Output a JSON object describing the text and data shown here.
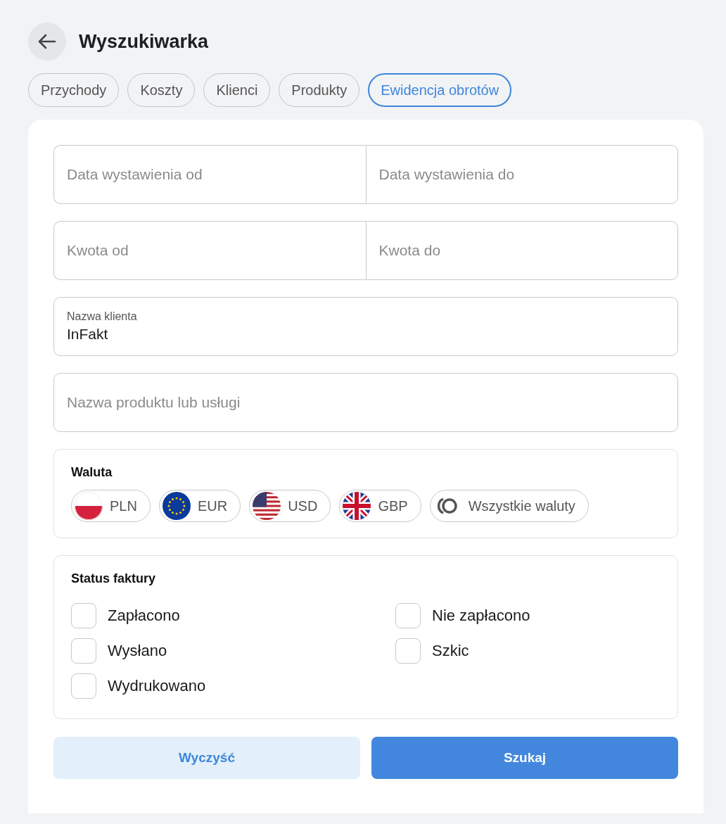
{
  "header": {
    "title": "Wyszukiwarka"
  },
  "tabs": [
    {
      "label": "Przychody",
      "selected": false
    },
    {
      "label": "Koszty",
      "selected": false
    },
    {
      "label": "Klienci",
      "selected": false
    },
    {
      "label": "Produkty",
      "selected": false
    },
    {
      "label": "Ewidencja obrotów",
      "selected": true
    }
  ],
  "fields": [
    {
      "cells": [
        {
          "placeholder": "Data wystawienia od"
        },
        {
          "placeholder": "Data wystawienia do"
        }
      ]
    },
    {
      "cells": [
        {
          "placeholder": "Kwota od"
        },
        {
          "placeholder": "Kwota do"
        }
      ]
    },
    {
      "cells": [
        {
          "label": "Nazwa klienta",
          "value": "InFakt"
        }
      ]
    },
    {
      "cells": [
        {
          "placeholder": "Nazwa produktu lub usługi"
        }
      ]
    }
  ],
  "currency": {
    "title": "Waluta",
    "options": [
      {
        "kind": "pl",
        "label": "PLN",
        "selected": false
      },
      {
        "kind": "eu",
        "label": "EUR",
        "selected": false
      },
      {
        "kind": "us",
        "label": "USD",
        "selected": false
      },
      {
        "kind": "gb",
        "label": "GBP",
        "selected": false
      },
      {
        "kind": "all",
        "label": "Wszystkie waluty",
        "selected": false
      }
    ]
  },
  "status": {
    "title": "Status faktury",
    "options": [
      {
        "label": "Zapłacono",
        "checked": false
      },
      {
        "label": "Nie zapłacono",
        "checked": false
      },
      {
        "label": "Wysłano",
        "checked": false
      },
      {
        "label": "Szkic",
        "checked": false
      },
      {
        "label": "Wydrukowano",
        "checked": false
      }
    ]
  },
  "buttons": [
    {
      "kind": "secondary",
      "label": "Wyczyść"
    },
    {
      "kind": "primary",
      "label": "Szukaj"
    }
  ]
}
